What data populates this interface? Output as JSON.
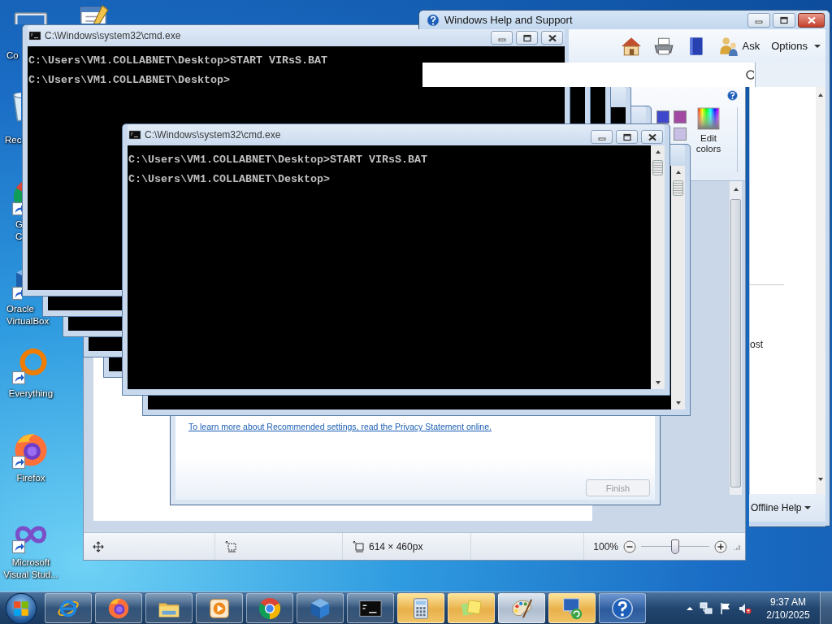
{
  "desktop_icons": [
    {
      "kind": "computer",
      "lines": [
        "Co"
      ]
    },
    {
      "kind": "recycle_bin",
      "lines": [
        "Rec"
      ]
    },
    {
      "kind": "chrome",
      "lines": [
        "G",
        "C"
      ]
    },
    {
      "kind": "virtualbox",
      "lines": [
        "Oracle",
        "VirtualBox"
      ]
    },
    {
      "kind": "everything",
      "lines": [
        "Everything"
      ]
    },
    {
      "kind": "firefox",
      "lines": [
        "Firefox"
      ]
    },
    {
      "kind": "visual_studio",
      "lines": [
        "Microsoft",
        "Visual Stud..."
      ]
    }
  ],
  "paint_window": {
    "palette": [
      {
        "color": "#3f48cc"
      },
      {
        "color": "#a349a4"
      },
      {
        "color": "#c8bfe7"
      }
    ],
    "edit_colors": "Edit colors",
    "status_bar": {
      "image_size": "614 × 460px",
      "zoom": "100%",
      "zoom_slider": {
        "level": 0.5
      }
    }
  },
  "setup_dialog": {
    "link": "To learn more about Recommended settings, read the Privacy Statement online.",
    "button": {
      "label": "Finish",
      "disabled": true
    }
  },
  "console_windows": [
    {
      "title": "C:\\Windows\\system32\\cmd.exe",
      "lines": [
        "C:\\Users\\VM1.COLLABNET\\Desktop>START VIRsS.BAT",
        "C:\\Users\\VM1.COLLABNET\\Desktop>"
      ]
    },
    {
      "title": "C:\\Windows\\system32\\cmd.exe",
      "lines": [
        "C:\\Users\\VM1.COLLABNET\\Desktop>START VIRsS.BAT",
        "C:\\Users\\VM1.COLLABNET\\Desktop>"
      ]
    }
  ],
  "help_window": {
    "title": "Windows Help and Support",
    "toolbar": {
      "ask": "Ask",
      "options": "Options"
    },
    "pane_text": "ost",
    "footer": "Offline Help"
  },
  "taskbar": {
    "apps": [
      {
        "kind": "ie"
      },
      {
        "kind": "firefox"
      },
      {
        "kind": "explorer"
      },
      {
        "kind": "media_player"
      },
      {
        "kind": "chrome"
      },
      {
        "kind": "virtualbox"
      },
      {
        "kind": "console"
      },
      {
        "kind": "calculator"
      },
      {
        "kind": "sticky_notes"
      },
      {
        "kind": "paint"
      },
      {
        "kind": "remote_desktop"
      },
      {
        "kind": "help"
      }
    ],
    "clock": {
      "time": "9:37 AM",
      "date": "2/10/2025"
    }
  }
}
